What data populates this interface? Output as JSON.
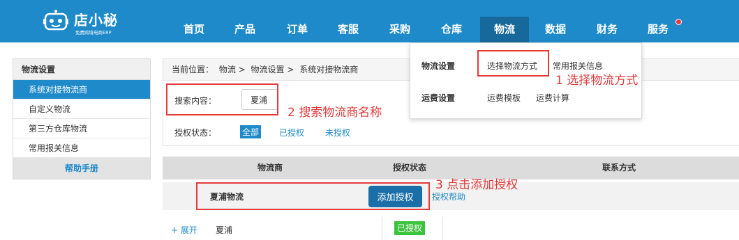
{
  "brand": {
    "name": "店小秘",
    "tagline": "免费跨境电商ERP"
  },
  "nav": [
    {
      "label": "首页"
    },
    {
      "label": "产品"
    },
    {
      "label": "订单"
    },
    {
      "label": "客服"
    },
    {
      "label": "采购"
    },
    {
      "label": "仓库"
    },
    {
      "label": "物流"
    },
    {
      "label": "数据"
    },
    {
      "label": "财务"
    },
    {
      "label": "服务"
    }
  ],
  "nav_active": "物流",
  "dropdown": {
    "groups": [
      {
        "title": "物流设置",
        "links": [
          "选择物流方式",
          "常用报关信息"
        ]
      },
      {
        "title": "运费设置",
        "links": [
          "运费模板",
          "运费计算"
        ]
      }
    ]
  },
  "sidebar": {
    "title": "物流设置",
    "items": [
      {
        "label": "系统对接物流商",
        "active": true
      },
      {
        "label": "自定义物流"
      },
      {
        "label": "第三方仓库物流"
      },
      {
        "label": "常用报关信息"
      }
    ],
    "help": "帮助手册"
  },
  "breadcrumb": {
    "prefix": "当前位置：",
    "parts": [
      "物流 >",
      "物流设置 >",
      "系统对接物流商"
    ]
  },
  "search": {
    "label": "搜索内容：",
    "value": "夏浦"
  },
  "auth_filter": {
    "label": "授权状态：",
    "options": [
      "全部",
      "已授权",
      "未授权"
    ],
    "selected": "全部"
  },
  "table": {
    "headers": [
      "物流商",
      "授权状态",
      "联系方式"
    ],
    "provider": {
      "name": "夏浦物流",
      "add_button": "添加授权",
      "help_link": "授权帮助"
    },
    "row": {
      "expand": "+ 展开",
      "name": "夏浦",
      "status": "已授权"
    }
  },
  "annotations": [
    "1  选择物流方式",
    "2  搜索物流商名称",
    "3  点击添加授权"
  ],
  "colors": {
    "primary": "#1f8ac9",
    "annotation": "#e33a3a",
    "authorized": "#3cc33c"
  }
}
